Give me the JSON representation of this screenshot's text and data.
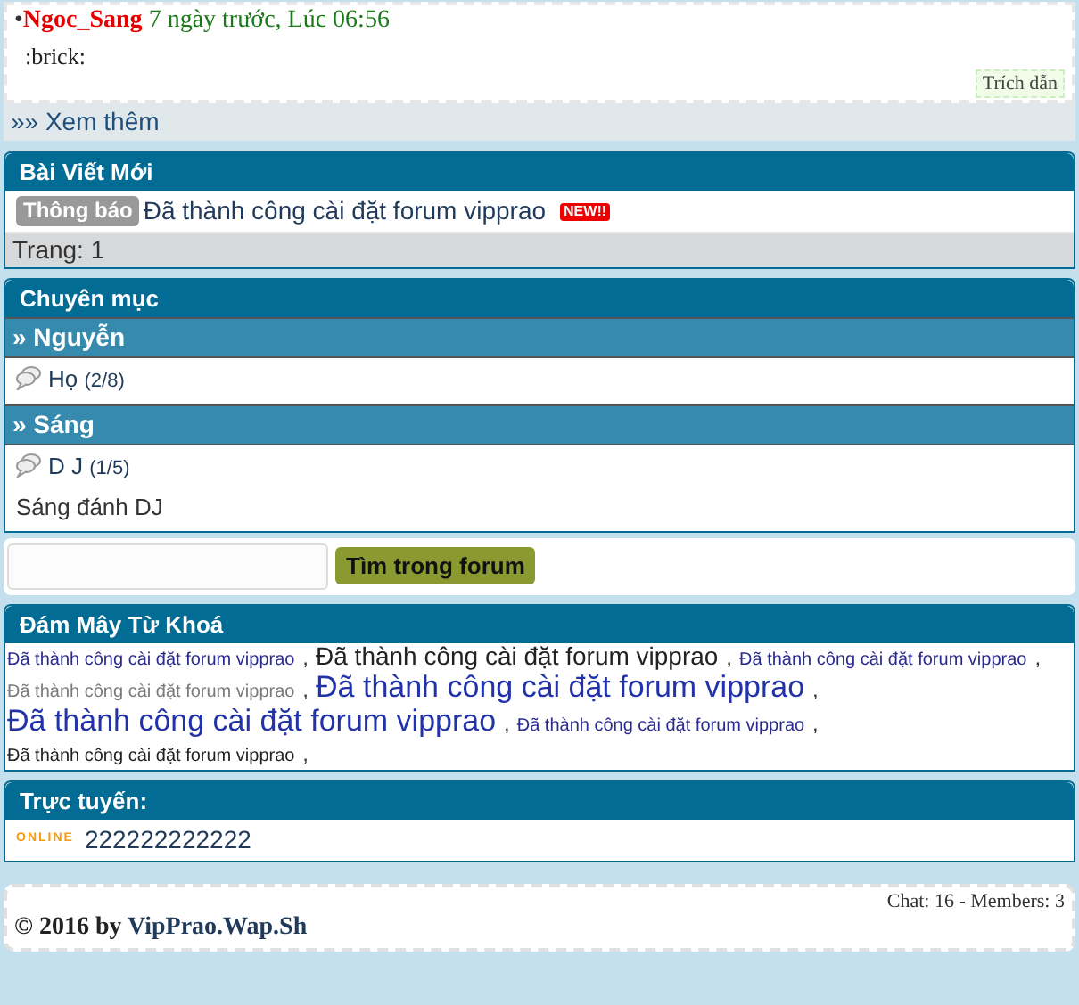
{
  "post": {
    "bullet": "•",
    "author": "Ngoc_Sang",
    "time": "7 ngày trước, Lúc 06:56",
    "body": ":brick:",
    "quote_button": "Trích dẫn"
  },
  "more_link": "»» Xem thêm",
  "new_posts": {
    "title": "Bài Viết Mới",
    "items": [
      {
        "tag": "Thông báo",
        "title": "Đã thành công cài đặt forum vipprao",
        "badge": "NEW!!"
      }
    ],
    "pagination": "Trang: 1"
  },
  "categories": {
    "title": "Chuyên mục",
    "groups": [
      {
        "name": "» Nguyễn",
        "forums": [
          {
            "name": "Họ",
            "count": "(2/8)"
          }
        ]
      },
      {
        "name": "» Sáng",
        "forums": [
          {
            "name": "D J",
            "count": "(1/5)"
          }
        ],
        "description": "Sáng đánh DJ"
      }
    ]
  },
  "search": {
    "button": "Tìm trong forum"
  },
  "tag_cloud": {
    "title": "Đám Mây Từ Khoá",
    "tags": [
      {
        "text": "Đã thành công cài đặt forum vipprao",
        "sep": ",",
        "kind": "small",
        "color": "#2b2b8f"
      },
      {
        "text": "Đã thành công cài đặt forum vipprao",
        "sep": ",",
        "kind": "medium",
        "color": "#222222"
      },
      {
        "text": "Đã thành công cài đặt forum vipprao",
        "sep": ",",
        "kind": "small",
        "color": "#2b2b8f"
      },
      {
        "text": "Đã thành công cài đặt forum vipprao",
        "sep": ",",
        "kind": "small",
        "color": "#7a7a7a"
      },
      {
        "text": "Đã thành công cài đặt forum vipprao",
        "sep": ",",
        "kind": "large",
        "color": "#2233aa"
      },
      {
        "text": "Đã thành công cài đặt forum vipprao",
        "sep": ",",
        "kind": "large",
        "color": "#2233aa"
      },
      {
        "text": "Đã thành công cài đặt forum vipprao",
        "sep": ",",
        "kind": "small",
        "color": "#2b2b8f"
      },
      {
        "text": "Đã thành công cài đặt forum vipprao",
        "sep": ",",
        "kind": "small",
        "color": "#222222"
      }
    ]
  },
  "online": {
    "title": "Trực tuyến:",
    "badge": "ONLINE",
    "users": [
      "222222222222"
    ]
  },
  "footer": {
    "stats": "Chat: 16 - Members: 3",
    "copyright": "© 2016 by",
    "site": "VipPrao.Wap.Sh"
  }
}
